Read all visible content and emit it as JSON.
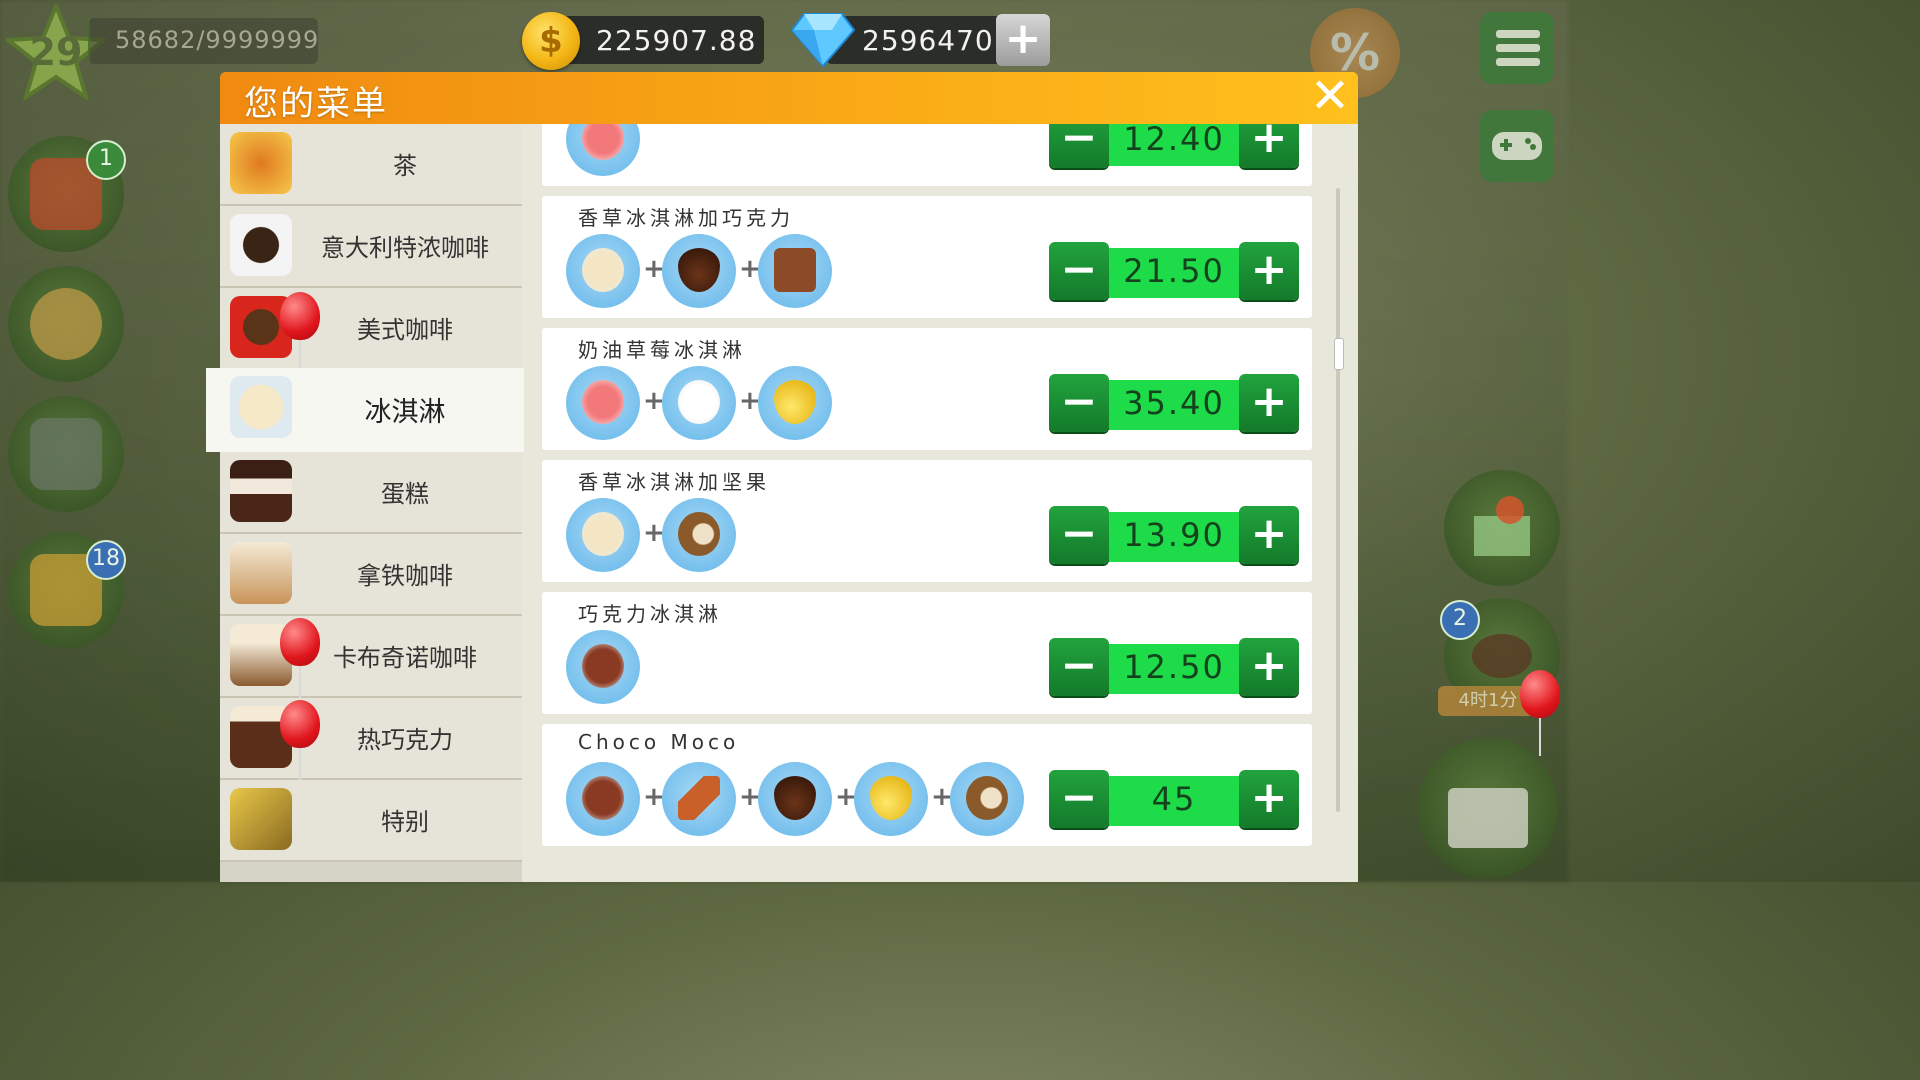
{
  "hud": {
    "level": "29",
    "xp_text": "58682/9999999",
    "xp_fraction": 0.0059,
    "coins": "225907.88",
    "gems": "2596470",
    "add_button": "+"
  },
  "side_badges": {
    "recipe_book": "1",
    "gift": "18",
    "coffee_orders": "2"
  },
  "timer": "4时1分",
  "dialog": {
    "title": "您的菜单",
    "close": "✕"
  },
  "categories": [
    {
      "label": "茶",
      "icon": "tea-cup-icon",
      "balloon": false
    },
    {
      "label": "意大利特浓咖啡",
      "icon": "espresso-cup-icon",
      "balloon": false
    },
    {
      "label": "美式咖啡",
      "icon": "americano-cup-icon",
      "balloon": true
    },
    {
      "label": "冰淇淋",
      "icon": "ice-cream-icon",
      "balloon": false,
      "active": true
    },
    {
      "label": "蛋糕",
      "icon": "cake-slice-icon",
      "balloon": false
    },
    {
      "label": "拿铁咖啡",
      "icon": "latte-glass-icon",
      "balloon": false
    },
    {
      "label": "卡布奇诺咖啡",
      "icon": "cappuccino-glass-icon",
      "balloon": true
    },
    {
      "label": "热巧克力",
      "icon": "hot-chocolate-icon",
      "balloon": true
    },
    {
      "label": "特别",
      "icon": "special-drink-icon",
      "balloon": false
    }
  ],
  "recipes": [
    {
      "name": "",
      "ingredients": [
        "strawberry-ice-cream-icon"
      ],
      "price": "12.40"
    },
    {
      "name": "香草冰淇淋加巧克力",
      "ingredients": [
        "vanilla-ice-cream-icon",
        "chocolate-syrup-icon",
        "chocolate-bar-icon"
      ],
      "price": "21.50"
    },
    {
      "name": "奶油草莓冰淇淋",
      "ingredients": [
        "strawberry-ice-cream-icon",
        "whipped-cream-icon",
        "honey-drop-icon"
      ],
      "price": "35.40"
    },
    {
      "name": "香草冰淇淋加坚果",
      "ingredients": [
        "vanilla-ice-cream-icon",
        "hazelnut-icon"
      ],
      "price": "13.90"
    },
    {
      "name": "巧克力冰淇淋",
      "ingredients": [
        "chocolate-ice-cream-icon"
      ],
      "price": "12.50"
    },
    {
      "name": "Choco Moco",
      "ingredients": [
        "chocolate-ice-cream-icon",
        "cinnamon-icon",
        "chocolate-syrup-icon",
        "honey-drop-icon",
        "hazelnut-icon"
      ],
      "price": "45"
    }
  ],
  "buttons": {
    "minus": "−",
    "plus": "+"
  }
}
